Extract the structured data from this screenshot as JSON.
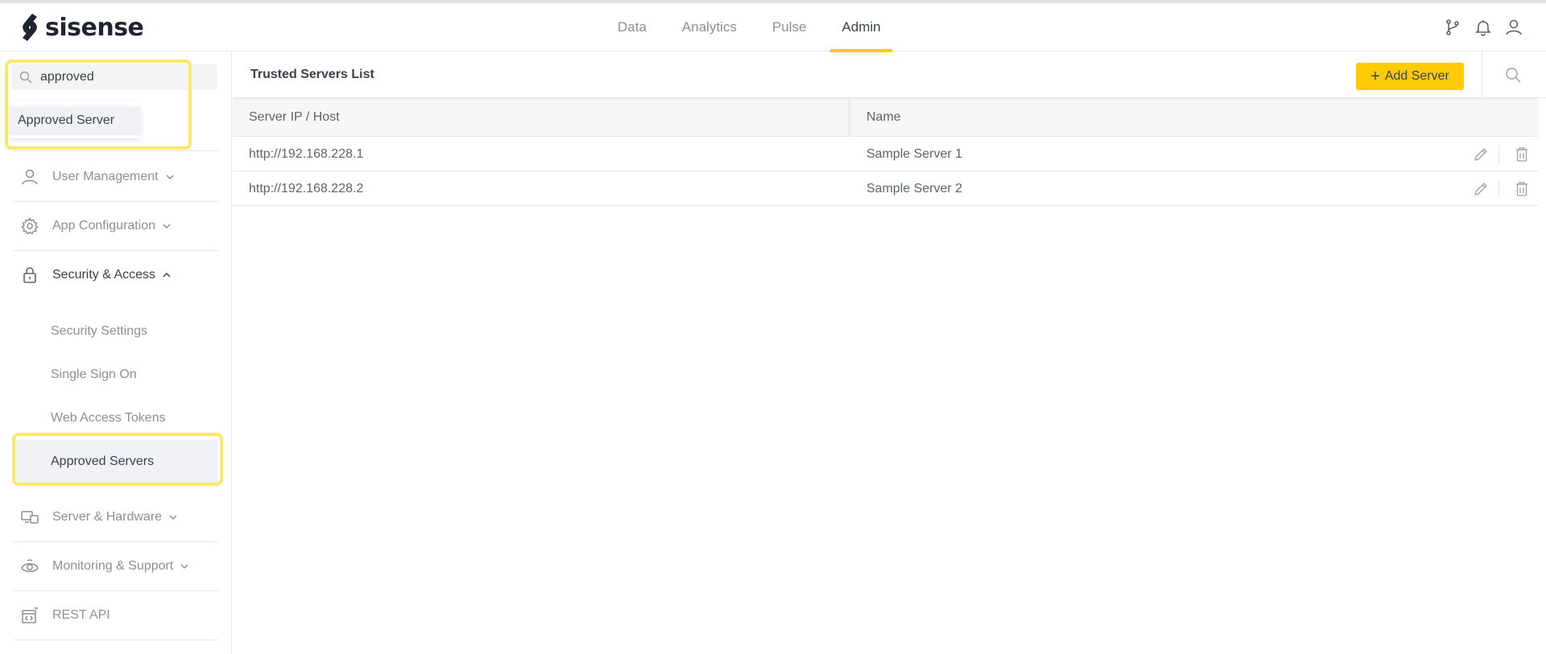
{
  "app": {
    "logo_text": "sisense"
  },
  "nav": {
    "tabs": [
      {
        "label": "Data"
      },
      {
        "label": "Analytics"
      },
      {
        "label": "Pulse"
      },
      {
        "label": "Admin"
      }
    ],
    "active_tab": "Admin"
  },
  "top_icons": [
    "branch-icon",
    "bell-icon",
    "user-icon"
  ],
  "sidebar": {
    "search": {
      "value": "approved",
      "placeholder": ""
    },
    "suggestion": "Approved Server",
    "menu": {
      "user_management": "User Management",
      "app_configuration": "App Configuration",
      "security_access": "Security & Access",
      "server_hardware": "Server & Hardware",
      "monitoring_support": "Monitoring & Support",
      "rest_api": "REST API"
    },
    "security_sub": {
      "security_settings": "Security Settings",
      "single_sign_on": "Single Sign On",
      "web_access_tokens": "Web Access Tokens",
      "approved_servers": "Approved Servers"
    }
  },
  "main": {
    "title": "Trusted Servers List",
    "add_button": "Add Server",
    "table": {
      "headers": {
        "ip": "Server IP / Host",
        "name": "Name"
      },
      "rows": [
        {
          "ip": "http://192.168.228.1",
          "name": "Sample Server 1"
        },
        {
          "ip": "http://192.168.228.2",
          "name": "Sample Server 2"
        }
      ]
    }
  },
  "colors": {
    "accent": "#ffcb05",
    "highlight": "#fbe86a",
    "text_dark": "#3a4150",
    "text_muted": "#8a8f99"
  }
}
